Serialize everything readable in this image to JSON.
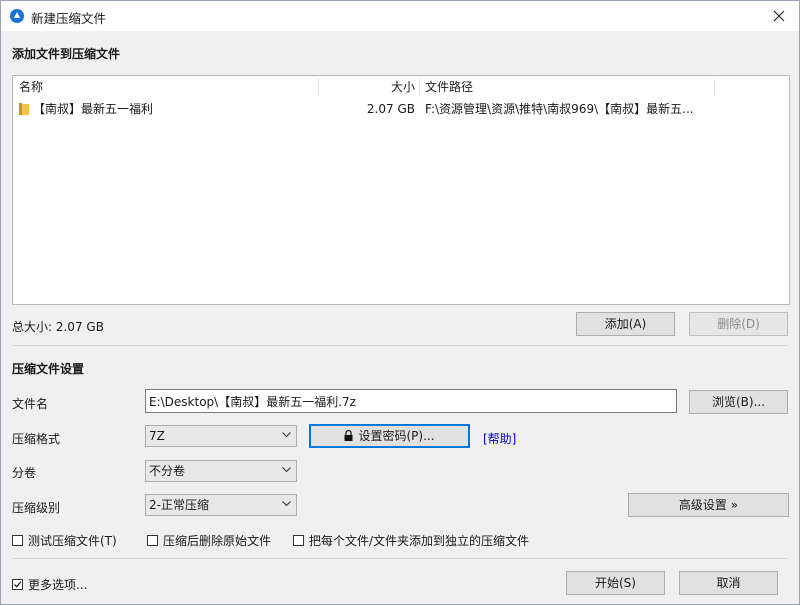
{
  "window": {
    "title": "新建压缩文件"
  },
  "add_section": {
    "title": "添加文件到压缩文件"
  },
  "file_list": {
    "columns": {
      "name": "名称",
      "size": "大小",
      "path": "文件路径"
    },
    "rows": [
      {
        "name": "【南叔】最新五一福利",
        "size": "2.07 GB",
        "path": "F:\\资源管理\\资源\\推特\\南叔969\\【南叔】最新五..."
      }
    ]
  },
  "total_size": "总大小: 2.07 GB",
  "buttons": {
    "add": "添加(A)",
    "delete": "删除(D)",
    "browse": "浏览(B)...",
    "set_password": "设置密码(P)...",
    "advanced": "高级设置 »",
    "start": "开始(S)",
    "cancel": "取消"
  },
  "settings": {
    "title": "压缩文件设置",
    "filename_label": "文件名",
    "filename_value": "E:\\Desktop\\【南叔】最新五一福利.7z",
    "format_label": "压缩格式",
    "format_value": "7Z",
    "help": "[帮助]",
    "split_label": "分卷",
    "split_value": "不分卷",
    "level_label": "压缩级别",
    "level_value": "2-正常压缩"
  },
  "options": {
    "test_archive": {
      "label": "测试压缩文件(T)",
      "checked": false
    },
    "delete_original": {
      "label": "压缩后删除原始文件",
      "checked": false
    },
    "separate_archives": {
      "label": "把每个文件/文件夹添加到独立的压缩文件",
      "checked": false
    },
    "more_options": {
      "label": "更多选项...",
      "checked": true
    }
  }
}
